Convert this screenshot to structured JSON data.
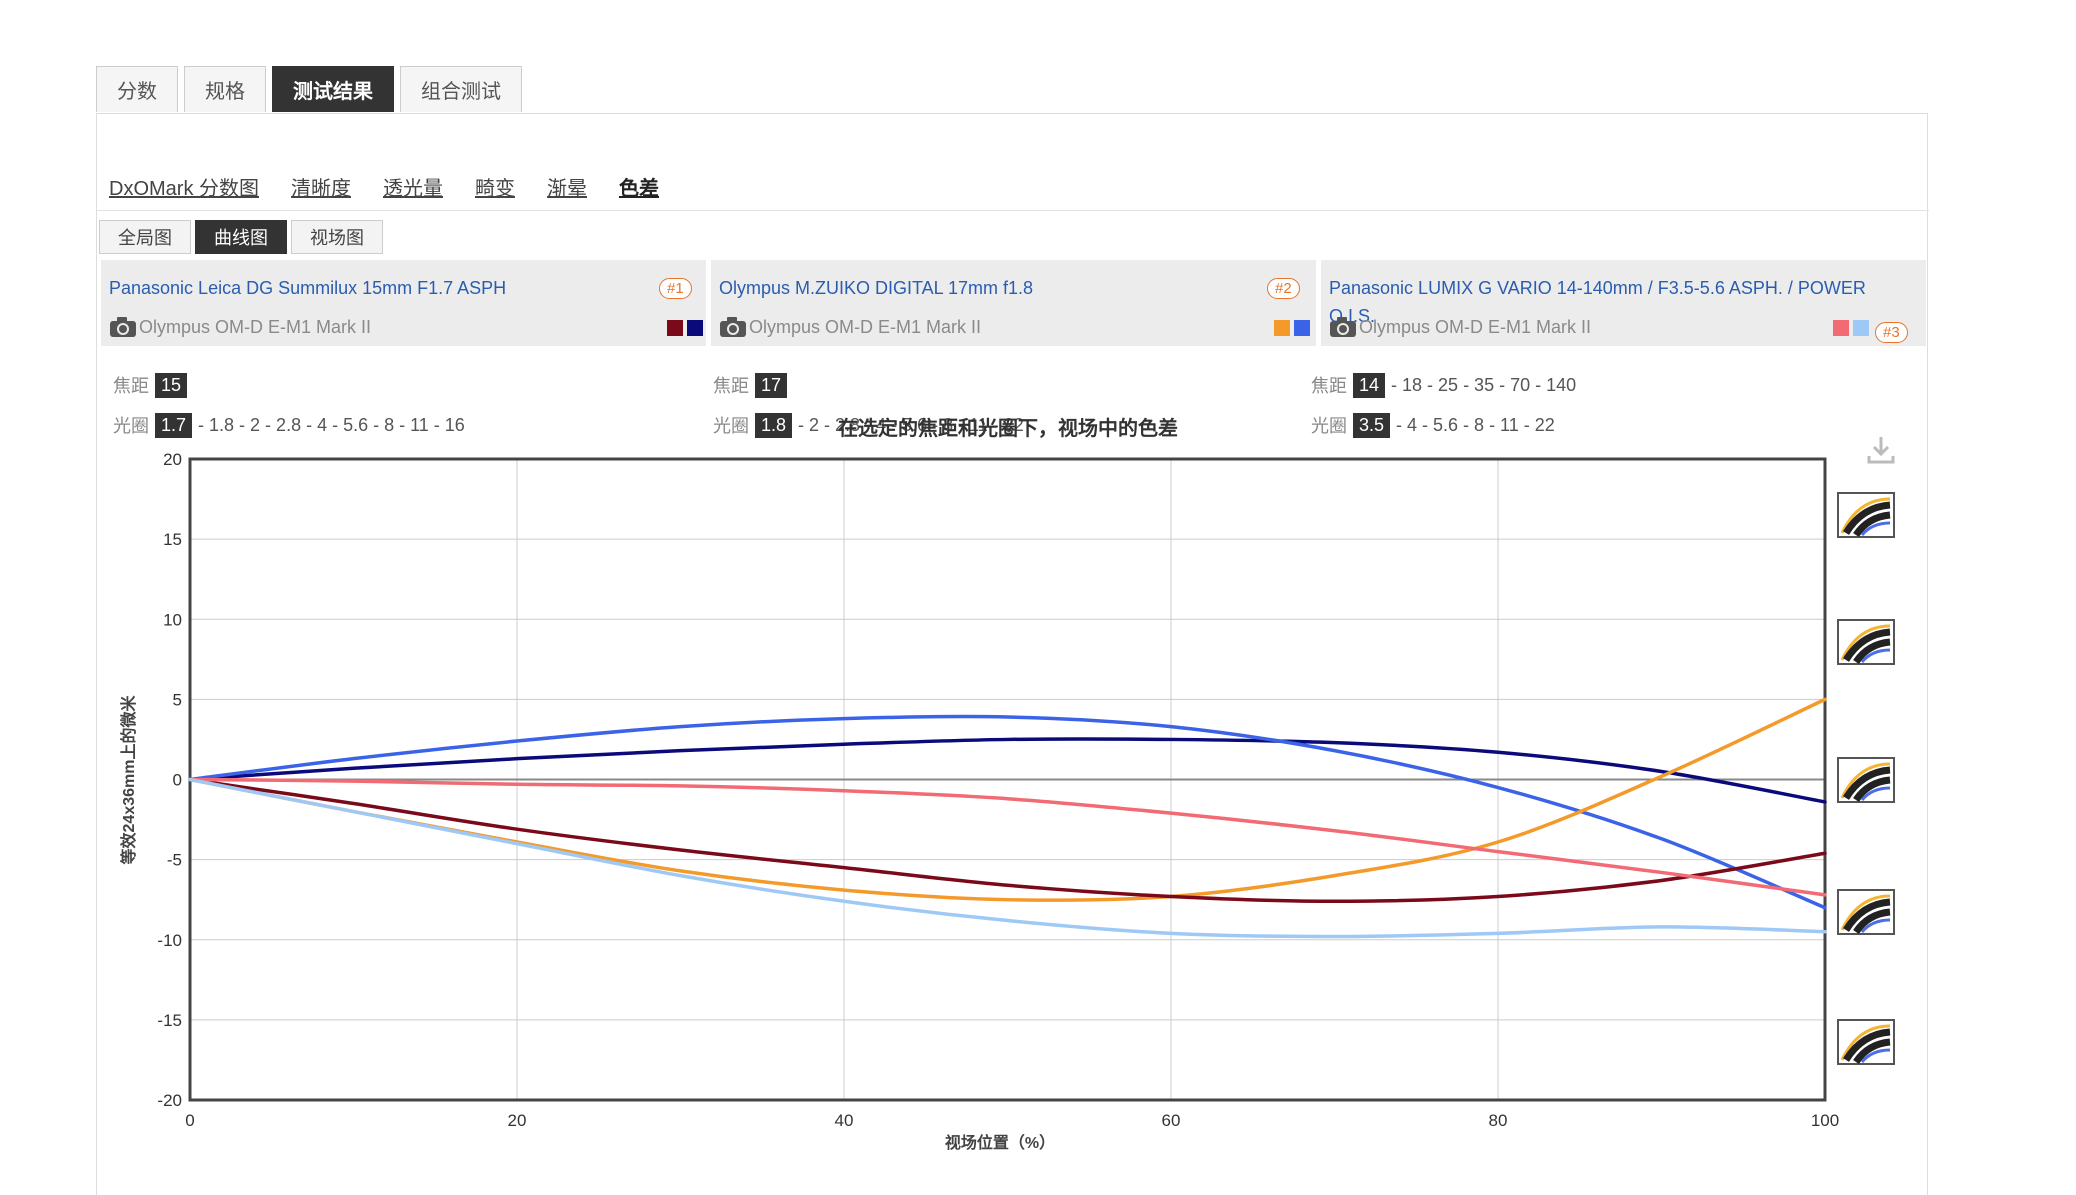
{
  "tabs": [
    "分数",
    "规格",
    "测试结果",
    "组合测试"
  ],
  "active_tab": "测试结果",
  "subnav": [
    "DxOMark 分数图",
    "清晰度",
    "透光量",
    "畸变",
    "渐晕",
    "色差"
  ],
  "active_subnav": "色差",
  "views": [
    "全局图",
    "曲线图",
    "视场图"
  ],
  "active_view": "曲线图",
  "lenses": [
    {
      "name": "Panasonic Leica DG Summilux 15mm F1.7 ASPH",
      "camera": "Olympus OM-D E-M1 Mark II",
      "badge": "#1",
      "colors": [
        "#7a0a1a",
        "#0a0a7a"
      ],
      "focal_label": "焦距",
      "focal_selected": "15",
      "focal_others": "",
      "aperture_label": "光圈",
      "aperture_selected": "1.7",
      "aperture_others": " - 1.8 - 2 - 2.8 - 4 - 5.6 - 8 - 11 - 16"
    },
    {
      "name": "Olympus M.ZUIKO DIGITAL 17mm f1.8",
      "camera": "Olympus OM-D E-M1 Mark II",
      "badge": "#2",
      "colors": [
        "#f39a2b",
        "#3b63e8"
      ],
      "focal_label": "焦距",
      "focal_selected": "17",
      "focal_others": "",
      "aperture_label": "光圈",
      "aperture_selected": "1.8",
      "aperture_others": " - 2 - 2.8 - 4 - 5.6 - 8 - 11 - 22"
    },
    {
      "name": "Panasonic LUMIX G VARIO 14-140mm / F3.5-5.6 ASPH. / POWER O.I.S.",
      "camera": "Olympus OM-D E-M1 Mark II",
      "badge": "#3",
      "colors": [
        "#f26a73",
        "#9ec8f5"
      ],
      "focal_label": "焦距",
      "focal_selected": "14",
      "focal_others": " - 18 - 25 - 35 - 70 - 140",
      "aperture_label": "光圈",
      "aperture_selected": "3.5",
      "aperture_others": " - 4 - 5.6 - 8 - 11 - 22"
    }
  ],
  "chart_data": {
    "type": "line",
    "title": "在选定的焦距和光圈下，视场中的色差",
    "xlabel": "视场位置（%）",
    "ylabel": "等效24x36mm上的微米",
    "xlim": [
      0,
      100
    ],
    "ylim": [
      -20,
      20
    ],
    "xticks": [
      0,
      20,
      40,
      60,
      80,
      100
    ],
    "yticks": [
      20,
      15,
      10,
      5,
      0,
      -5,
      -10,
      -15,
      -20
    ],
    "grid": true,
    "x": [
      0,
      10,
      20,
      30,
      40,
      50,
      60,
      70,
      80,
      90,
      100
    ],
    "series": [
      {
        "color": "#0a0a7a",
        "values": [
          0,
          0.7,
          1.3,
          1.8,
          2.2,
          2.5,
          2.5,
          2.3,
          1.7,
          0.5,
          -1.4
        ]
      },
      {
        "color": "#3b63e8",
        "values": [
          0,
          1.3,
          2.4,
          3.3,
          3.8,
          3.9,
          3.3,
          1.8,
          -0.5,
          -3.7,
          -8.0
        ]
      },
      {
        "color": "#f39a2b",
        "values": [
          0,
          -2.0,
          -3.9,
          -5.7,
          -6.9,
          -7.5,
          -7.3,
          -6.0,
          -3.9,
          0.2,
          5.0
        ]
      },
      {
        "color": "#7a0a1a",
        "values": [
          0,
          -1.5,
          -3.1,
          -4.4,
          -5.5,
          -6.6,
          -7.3,
          -7.6,
          -7.3,
          -6.3,
          -4.6
        ]
      },
      {
        "color": "#f26a73",
        "values": [
          0,
          -0.1,
          -0.3,
          -0.4,
          -0.7,
          -1.2,
          -2.1,
          -3.2,
          -4.5,
          -5.8,
          -7.2
        ]
      },
      {
        "color": "#9ec8f5",
        "values": [
          0,
          -2.0,
          -4.0,
          -6.0,
          -7.6,
          -8.8,
          -9.6,
          -9.8,
          -9.6,
          -9.2,
          -9.5
        ]
      }
    ]
  }
}
